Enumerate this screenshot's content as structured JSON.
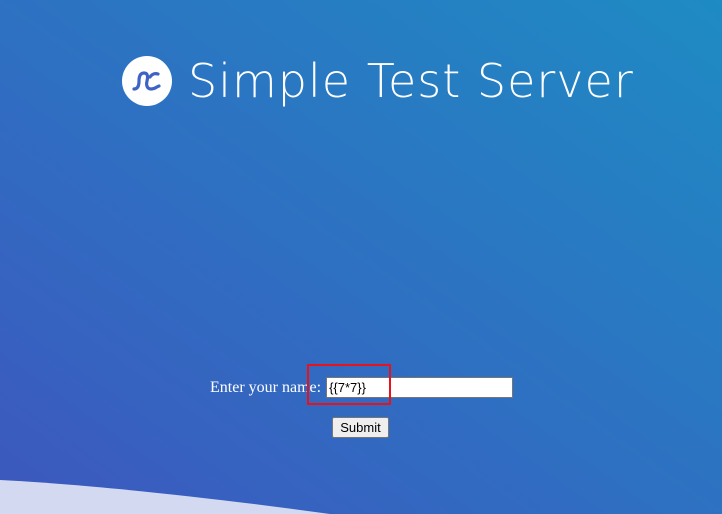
{
  "header": {
    "title": "Simple Test Server",
    "logo_icon": "wave-logo-icon"
  },
  "form": {
    "label": "Enter your name:",
    "name_value": "{{7*7}}",
    "submit_label": "Submit"
  },
  "colors": {
    "background_start": "#3d57be",
    "background_end": "#1e8bc3",
    "highlight": "#e8111c"
  }
}
